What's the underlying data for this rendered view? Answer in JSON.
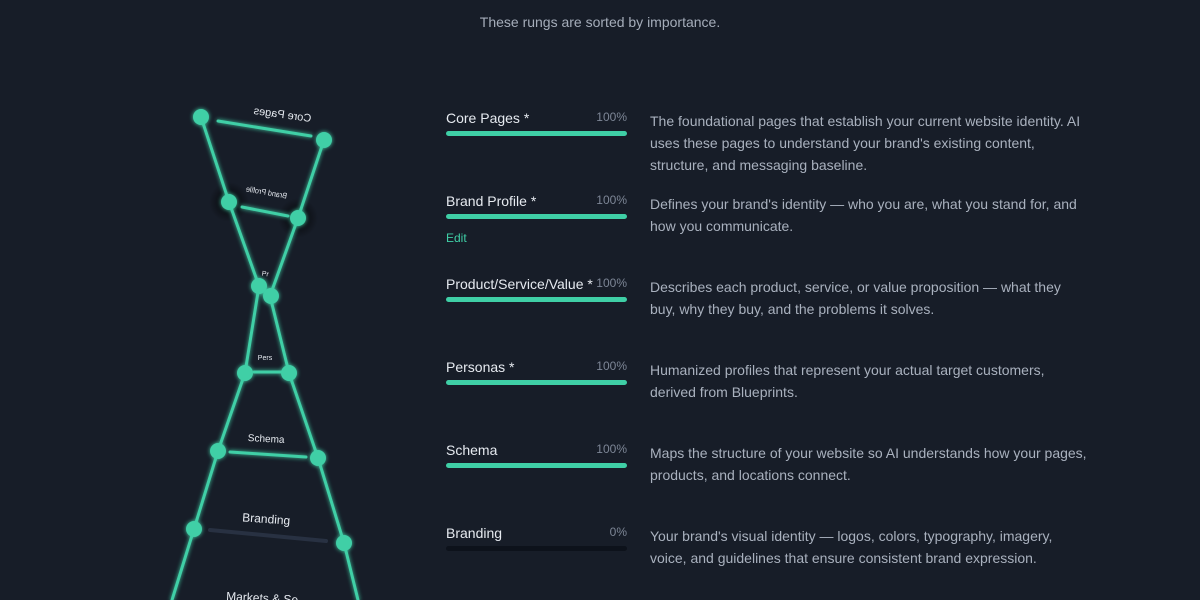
{
  "subtitle": "These rungs are sorted by importance.",
  "colors": {
    "accent": "#3fcfa6",
    "background": "#171d28",
    "track": "#0d121b"
  },
  "ladder": {
    "rung_labels": [
      "Core Pages",
      "Brand Profile",
      "Pr",
      "Pers",
      "Schema",
      "Branding",
      "Markets & Se"
    ]
  },
  "rungs": [
    {
      "label": "Core Pages *",
      "percent": "100%",
      "progress": 1.0,
      "description": "The foundational pages that establish your current website identity. AI uses these pages to understand your brand's existing content, structure, and messaging baseline."
    },
    {
      "label": "Brand Profile *",
      "percent": "100%",
      "progress": 1.0,
      "edit_label": "Edit",
      "description": "Defines your brand's identity — who you are, what you stand for, and how you communicate."
    },
    {
      "label": "Product/Service/Value *",
      "percent": "100%",
      "progress": 1.0,
      "description": "Describes each product, service, or value proposition — what they buy, why they buy, and the problems it solves."
    },
    {
      "label": "Personas *",
      "percent": "100%",
      "progress": 1.0,
      "description": "Humanized profiles that represent your actual target customers, derived from Blueprints."
    },
    {
      "label": "Schema",
      "percent": "100%",
      "progress": 1.0,
      "description": "Maps the structure of your website so AI understands how your pages, products, and locations connect."
    },
    {
      "label": "Branding",
      "percent": "0%",
      "progress": 0.0,
      "description": "Your brand's visual identity — logos, colors, typography, imagery, voice, and guidelines that ensure consistent brand expression."
    }
  ]
}
